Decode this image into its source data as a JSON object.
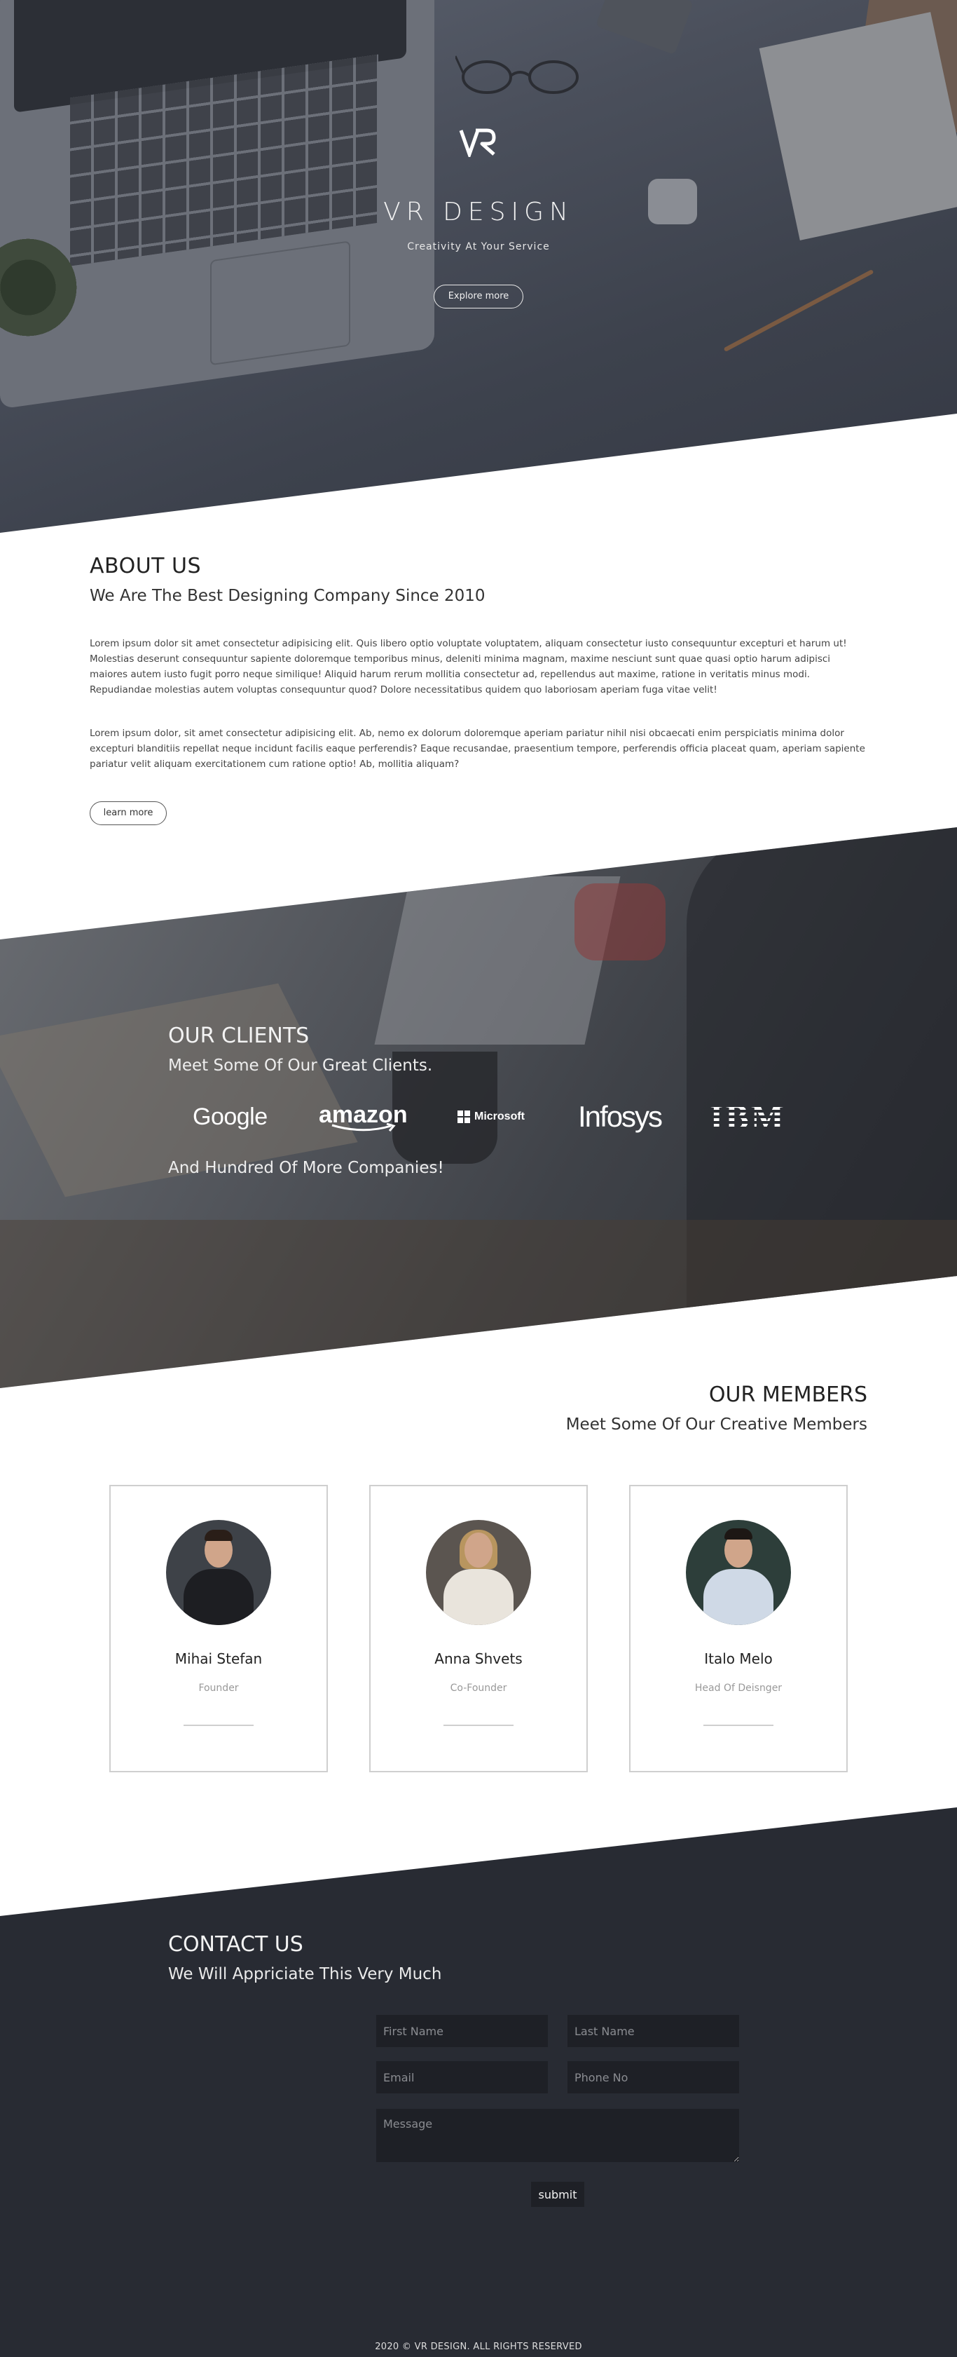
{
  "hero": {
    "brand_title": "VR DESIGN",
    "tagline": "Creativity At Your Service",
    "cta_label": "Explore more"
  },
  "about": {
    "heading": "ABOUT US",
    "subheading": "We Are The Best Designing Company Since 2010",
    "paragraph_1": "Lorem ipsum dolor sit amet consectetur adipisicing elit. Quis libero optio voluptate voluptatem, aliquam consectetur iusto consequuntur excepturi et harum ut! Molestias deserunt consequuntur sapiente doloremque temporibus minus, deleniti minima magnam, maxime nesciunt sunt quae quasi optio harum adipisci maiores autem iusto fugit porro neque similique! Aliquid harum rerum mollitia consectetur ad, repellendus aut maxime, ratione in veritatis minus modi. Repudiandae molestias autem voluptas consequuntur quod? Dolore necessitatibus quidem quo laboriosam aperiam fuga vitae velit!",
    "paragraph_2": "Lorem ipsum dolor, sit amet consectetur adipisicing elit. Ab, nemo ex dolorum doloremque aperiam pariatur nihil nisi obcaecati enim perspiciatis minima dolor excepturi blanditiis repellat neque incidunt facilis eaque perferendis? Eaque recusandae, praesentium tempore, perferendis officia placeat quam, aperiam sapiente pariatur velit aliquam exercitationem cum ratione optio! Ab, mollitia aliquam?",
    "button_label": "learn more"
  },
  "clients": {
    "heading": "OUR CLIENTS",
    "subheading": "Meet Some Of Our Great Clients.",
    "logos": [
      "Google",
      "amazon",
      "Microsoft",
      "Infosys",
      "IBM"
    ],
    "footer_text": "And Hundred Of More Companies!"
  },
  "members": {
    "heading": "OUR MEMBERS",
    "subheading": "Meet Some Of Our Creative Members",
    "people": [
      {
        "name": "Mihai Stefan",
        "role": "Founder"
      },
      {
        "name": "Anna Shvets",
        "role": "Co-Founder"
      },
      {
        "name": "Italo Melo",
        "role": "Head Of Deisnger"
      }
    ]
  },
  "contact": {
    "heading": "CONTACT US",
    "subheading": "We Will Appriciate This Very Much",
    "first_name_placeholder": "First Name",
    "last_name_placeholder": "Last Name",
    "email_placeholder": "Email",
    "phone_placeholder": "Phone No",
    "message_placeholder": "Message",
    "submit_label": "submit"
  },
  "footer": {
    "copyright": "2020 © VR DESIGN. ALL RIGHTS RESERVED"
  },
  "colors": {
    "dark_section": "#282b33",
    "input_bg": "#1e2026",
    "heading_text": "#222222"
  }
}
